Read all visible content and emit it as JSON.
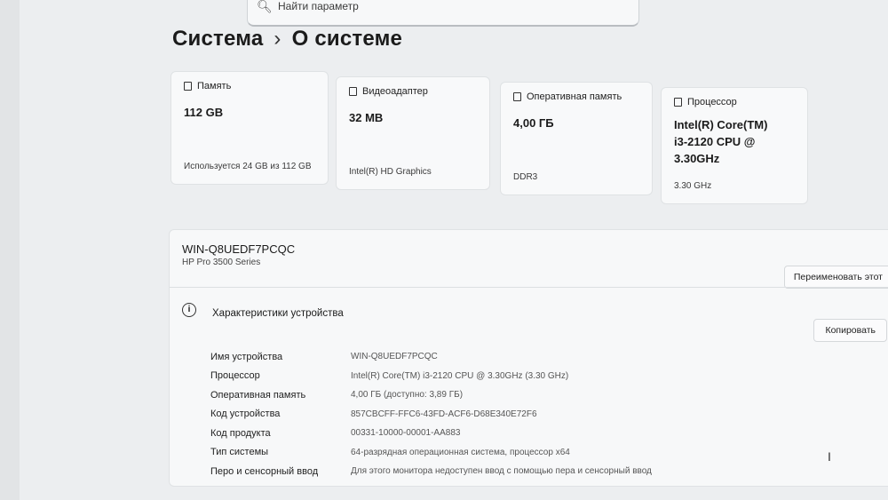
{
  "search": {
    "placeholder": "Найти параметр",
    "icon": "search-icon"
  },
  "breadcrumb": {
    "parent": "Система",
    "separator": "›",
    "current": "О системе"
  },
  "cards": [
    {
      "icon": "storage-icon",
      "label": "Память",
      "value": "112 GB",
      "sub": "Используется 24 GB из 112 GB"
    },
    {
      "icon": "display-icon",
      "label": "Видеоадаптер",
      "value": "32 MB",
      "sub": "Intel(R) HD Graphics"
    },
    {
      "icon": "ram-icon",
      "label": "Оперативная память",
      "value": "4,00 ГБ",
      "sub": "DDR3"
    },
    {
      "icon": "cpu-icon",
      "label": "Процессор",
      "value": "Intel(R) Core(TM) i3-2120 CPU @ 3.30GHz",
      "sub": "3.30 GHz"
    }
  ],
  "device": {
    "name": "WIN-Q8UEDF7PCQC",
    "model": "HP Pro 3500 Series",
    "rename_label": "Переименовать этот"
  },
  "specs": {
    "title": "Характеристики устройства",
    "copy_label": "Копировать",
    "rows": [
      {
        "key": "Имя устройства",
        "value": "WIN-Q8UEDF7PCQC"
      },
      {
        "key": "Процессор",
        "value": "Intel(R) Core(TM) i3-2120 CPU @ 3.30GHz (3.30 GHz)"
      },
      {
        "key": "Оперативная память",
        "value": "4,00 ГБ (доступно: 3,89 ГБ)"
      },
      {
        "key": "Код устройства",
        "value": "857CBCFF-FFC6-43FD-ACF6-D68E340E72F6"
      },
      {
        "key": "Код продукта",
        "value": "00331-10000-00001-AA883"
      },
      {
        "key": "Тип системы",
        "value": "64-разрядная операционная система, процессор x64"
      },
      {
        "key": "Перо и сенсорный ввод",
        "value": "Для этого монитора недоступен ввод с помощью пера и сенсорный ввод"
      }
    ]
  }
}
